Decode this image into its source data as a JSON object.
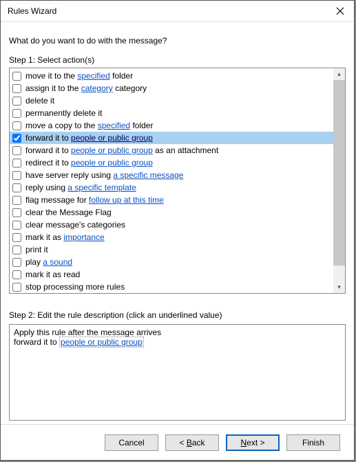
{
  "title": "Rules Wizard",
  "question": "What do you want to do with the message?",
  "step1_label": "Step 1: Select action(s)",
  "actions": [
    {
      "checked": false,
      "selected": false,
      "parts": [
        {
          "t": "text",
          "v": "move it to the "
        },
        {
          "t": "link",
          "v": "specified"
        },
        {
          "t": "text",
          "v": " folder"
        }
      ]
    },
    {
      "checked": false,
      "selected": false,
      "parts": [
        {
          "t": "text",
          "v": "assign it to the "
        },
        {
          "t": "link",
          "v": "category"
        },
        {
          "t": "text",
          "v": " category"
        }
      ]
    },
    {
      "checked": false,
      "selected": false,
      "parts": [
        {
          "t": "text",
          "v": "delete it"
        }
      ]
    },
    {
      "checked": false,
      "selected": false,
      "parts": [
        {
          "t": "text",
          "v": "permanently delete it"
        }
      ]
    },
    {
      "checked": false,
      "selected": false,
      "parts": [
        {
          "t": "text",
          "v": "move a copy to the "
        },
        {
          "t": "link",
          "v": "specified"
        },
        {
          "t": "text",
          "v": " folder"
        }
      ]
    },
    {
      "checked": true,
      "selected": true,
      "parts": [
        {
          "t": "text",
          "v": "forward it to "
        },
        {
          "t": "link",
          "v": "people or public group",
          "dark": true
        }
      ]
    },
    {
      "checked": false,
      "selected": false,
      "parts": [
        {
          "t": "text",
          "v": "forward it to "
        },
        {
          "t": "link",
          "v": "people or public group"
        },
        {
          "t": "text",
          "v": " as an attachment"
        }
      ]
    },
    {
      "checked": false,
      "selected": false,
      "parts": [
        {
          "t": "text",
          "v": "redirect it to "
        },
        {
          "t": "link",
          "v": "people or public group"
        }
      ]
    },
    {
      "checked": false,
      "selected": false,
      "parts": [
        {
          "t": "text",
          "v": "have server reply using "
        },
        {
          "t": "link",
          "v": "a specific message"
        }
      ]
    },
    {
      "checked": false,
      "selected": false,
      "parts": [
        {
          "t": "text",
          "v": "reply using "
        },
        {
          "t": "link",
          "v": "a specific template"
        }
      ]
    },
    {
      "checked": false,
      "selected": false,
      "parts": [
        {
          "t": "text",
          "v": "flag message for "
        },
        {
          "t": "link",
          "v": "follow up at this time"
        }
      ]
    },
    {
      "checked": false,
      "selected": false,
      "parts": [
        {
          "t": "text",
          "v": "clear the Message Flag"
        }
      ]
    },
    {
      "checked": false,
      "selected": false,
      "parts": [
        {
          "t": "text",
          "v": "clear message's categories"
        }
      ]
    },
    {
      "checked": false,
      "selected": false,
      "parts": [
        {
          "t": "text",
          "v": "mark it as "
        },
        {
          "t": "link",
          "v": "importance"
        }
      ]
    },
    {
      "checked": false,
      "selected": false,
      "parts": [
        {
          "t": "text",
          "v": "print it"
        }
      ]
    },
    {
      "checked": false,
      "selected": false,
      "parts": [
        {
          "t": "text",
          "v": "play "
        },
        {
          "t": "link",
          "v": "a sound"
        }
      ]
    },
    {
      "checked": false,
      "selected": false,
      "parts": [
        {
          "t": "text",
          "v": "mark it as read"
        }
      ]
    },
    {
      "checked": false,
      "selected": false,
      "parts": [
        {
          "t": "text",
          "v": "stop processing more rules"
        }
      ]
    }
  ],
  "step2_label": "Step 2: Edit the rule description (click an underlined value)",
  "description": {
    "line1": "Apply this rule after the message arrives",
    "line2_pre": "forward it to ",
    "line2_link": "people or public group"
  },
  "buttons": {
    "cancel": "Cancel",
    "back_pre": "< ",
    "back_ul": "B",
    "back_post": "ack",
    "next_ul": "N",
    "next_post": "ext >",
    "finish": "Finish"
  }
}
